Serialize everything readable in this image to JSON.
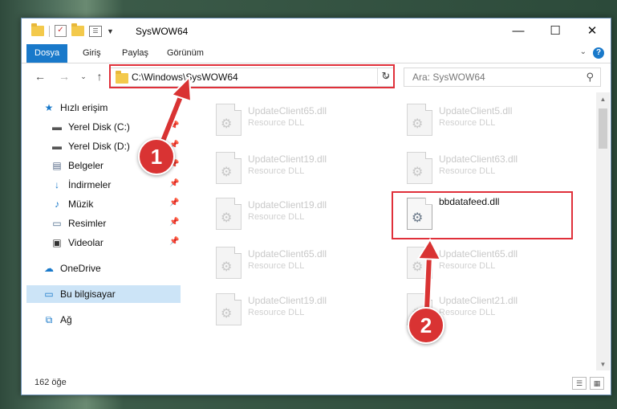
{
  "window": {
    "title": "SysWOW64"
  },
  "window_controls": {
    "minimize": "—",
    "maximize": "☐",
    "close": "✕"
  },
  "ribbon": {
    "tabs": [
      "Dosya",
      "Giriş",
      "Paylaş",
      "Görünüm"
    ],
    "help": "?"
  },
  "address": {
    "path": "C:\\Windows\\SysWOW64"
  },
  "search": {
    "placeholder": "Ara: SysWOW64"
  },
  "sidebar": {
    "items": [
      {
        "label": "Hızlı erişim",
        "icon": "star-icon"
      },
      {
        "label": "Yerel Disk (C:)",
        "icon": "drive-icon",
        "pinned": true
      },
      {
        "label": "Yerel Disk (D:)",
        "icon": "drive-icon",
        "pinned": true
      },
      {
        "label": "Belgeler",
        "icon": "documents-icon",
        "pinned": true
      },
      {
        "label": "İndirmeler",
        "icon": "download-icon",
        "pinned": true
      },
      {
        "label": "Müzik",
        "icon": "music-icon",
        "pinned": true
      },
      {
        "label": "Resimler",
        "icon": "pictures-icon",
        "pinned": true
      },
      {
        "label": "Videolar",
        "icon": "videos-icon",
        "pinned": true
      },
      {
        "label": "OneDrive",
        "icon": "cloud-icon"
      },
      {
        "label": "Bu bilgisayar",
        "icon": "computer-icon",
        "selected": true
      },
      {
        "label": "Ağ",
        "icon": "network-icon"
      }
    ]
  },
  "files": [
    {
      "name": "UpdateClient65.dll",
      "type": "Resource DLL"
    },
    {
      "name": "UpdateClient5.dll",
      "type": "Resource DLL"
    },
    {
      "name": "UpdateClient19.dll",
      "type": "Resource DLL"
    },
    {
      "name": "UpdateClient63.dll",
      "type": "Resource DLL"
    },
    {
      "name": "UpdateClient19.dll",
      "type": "Resource DLL"
    },
    {
      "name": "bbdatafeed.dll",
      "type": ""
    },
    {
      "name": "UpdateClient65.dll",
      "type": "Resource DLL"
    },
    {
      "name": "UpdateClient65.dll",
      "type": "Resource DLL"
    },
    {
      "name": "UpdateClient19.dll",
      "type": "Resource DLL"
    },
    {
      "name": "UpdateClient21.dll",
      "type": "Resource DLL"
    }
  ],
  "status": {
    "count": "162 öğe"
  },
  "callouts": [
    "1",
    "2"
  ],
  "colors": {
    "accent": "#1979ca",
    "highlight": "#e0303a",
    "selection": "#cce4f7"
  }
}
